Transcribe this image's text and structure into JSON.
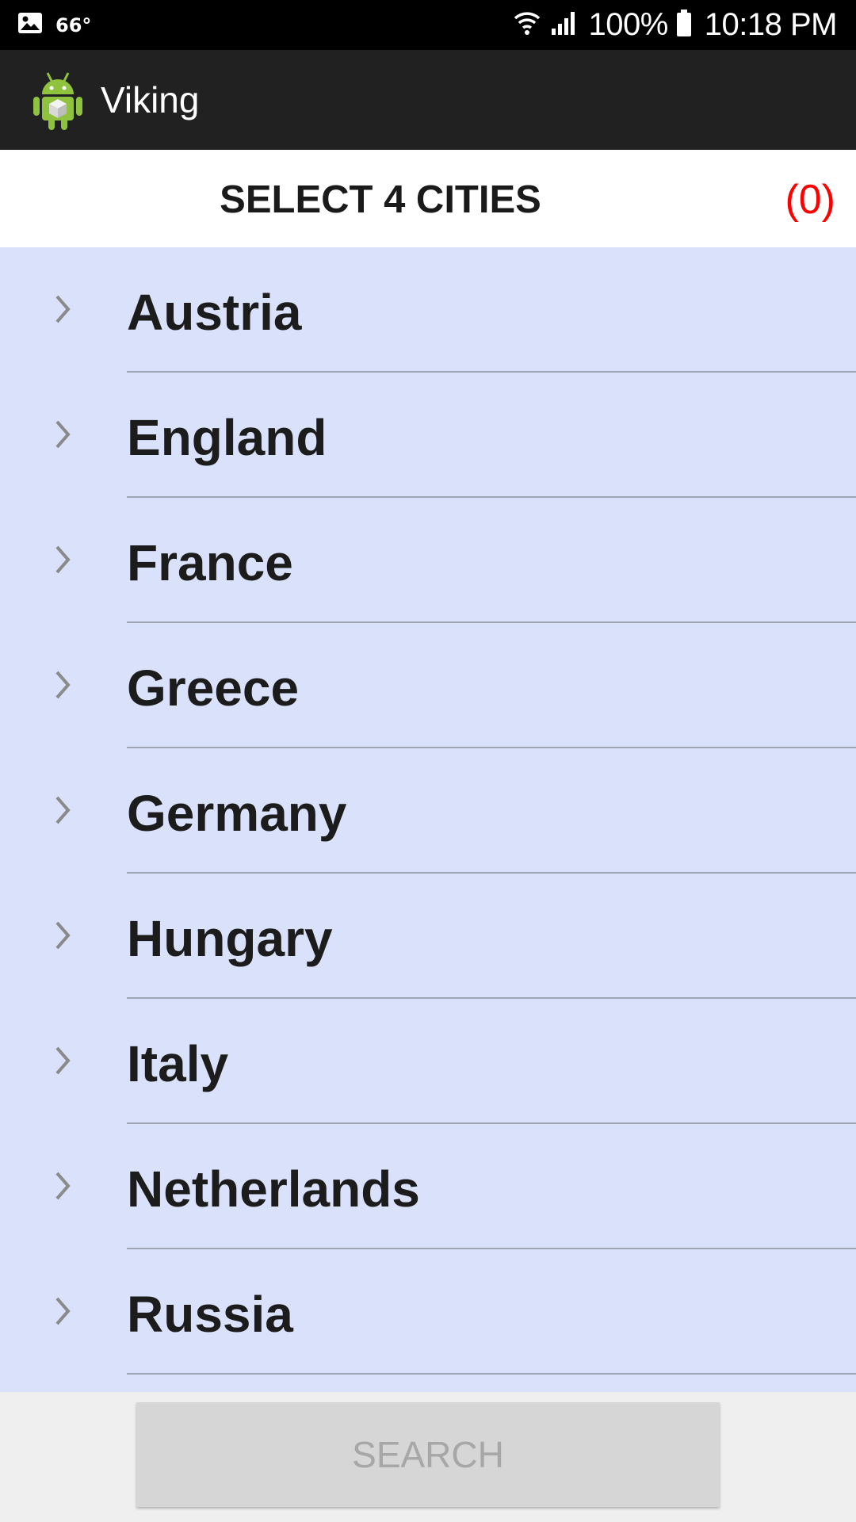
{
  "status_bar": {
    "temperature": "66°",
    "battery": "100%",
    "time": "10:18 PM",
    "icons": [
      "gallery-icon",
      "wifi-icon",
      "signal-icon",
      "battery-icon"
    ]
  },
  "app_bar": {
    "title": "Viking",
    "icon": "android-icon"
  },
  "header": {
    "title": "SELECT 4 CITIES",
    "count": "(0)",
    "count_color": "#ff0000"
  },
  "countries": [
    {
      "label": "Austria"
    },
    {
      "label": "England"
    },
    {
      "label": "France"
    },
    {
      "label": "Greece"
    },
    {
      "label": "Germany"
    },
    {
      "label": "Hungary"
    },
    {
      "label": "Italy"
    },
    {
      "label": "Netherlands"
    },
    {
      "label": "Russia"
    }
  ],
  "list_background": "#dae1fb",
  "search_button": {
    "label": "SEARCH",
    "enabled": false
  }
}
